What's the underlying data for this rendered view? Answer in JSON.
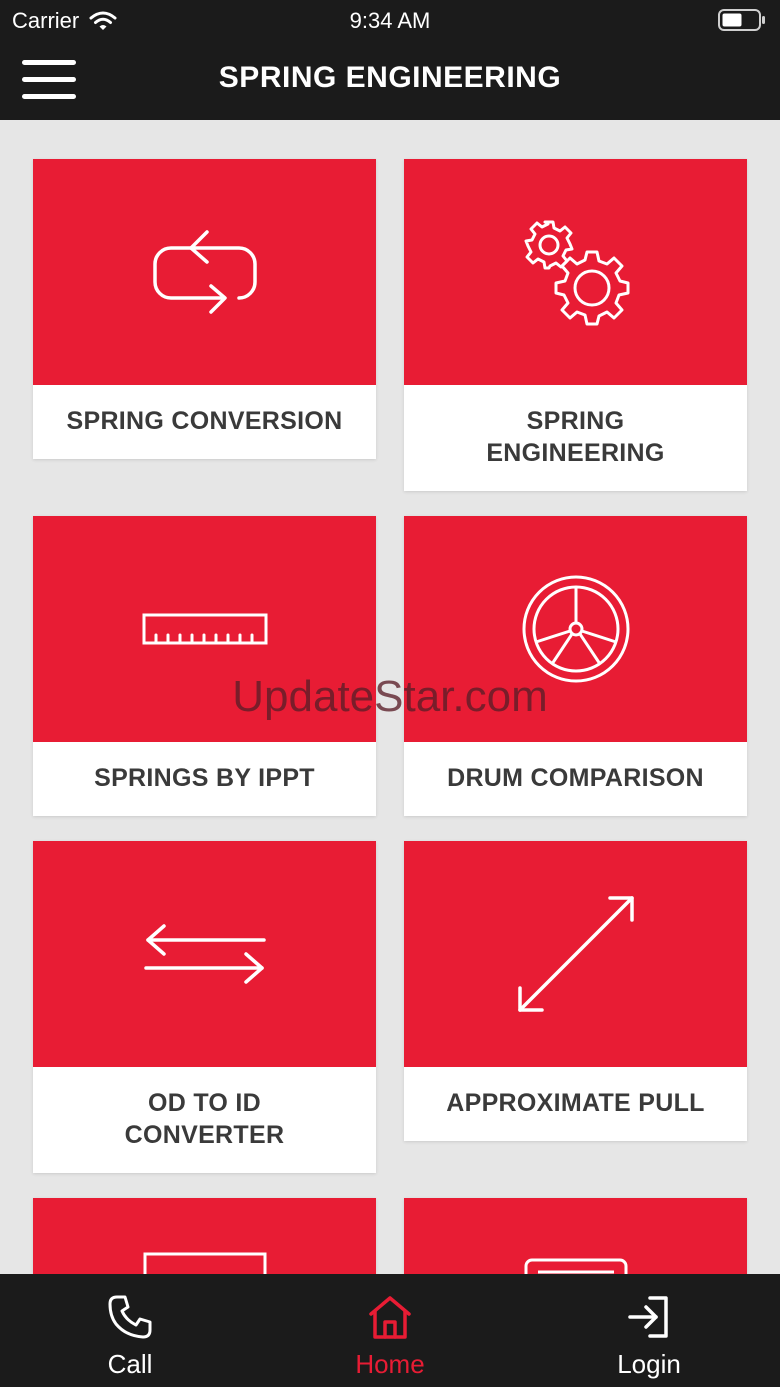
{
  "status_bar": {
    "carrier": "Carrier",
    "time": "9:34 AM"
  },
  "header": {
    "title": "SPRING ENGINEERING",
    "menu_icon": "hamburger-menu-icon"
  },
  "tiles": [
    {
      "label": "SPRING CONVERSION",
      "icon": "conversion-cycle-icon"
    },
    {
      "label": "SPRING\nENGINEERING",
      "icon": "gears-icon"
    },
    {
      "label": "SPRINGS BY IPPT",
      "icon": "ruler-icon"
    },
    {
      "label": "DRUM COMPARISON",
      "icon": "drum-wheel-icon"
    },
    {
      "label": "OD TO ID\nCONVERTER",
      "icon": "swap-arrows-icon"
    },
    {
      "label": "APPROXIMATE PULL",
      "icon": "diagonal-arrow-icon"
    },
    {
      "icon": "rectangle-icon"
    },
    {
      "icon": "card-icon"
    }
  ],
  "watermark": "UpdateStar.com",
  "tab_bar": [
    {
      "label": "Call",
      "icon": "phone-icon",
      "active": false
    },
    {
      "label": "Home",
      "icon": "home-icon",
      "active": true
    },
    {
      "label": "Login",
      "icon": "login-icon",
      "active": false
    }
  ],
  "colors": {
    "accent": "#e81c34",
    "bar_background": "#1b1b1b",
    "page_background": "#e6e6e6",
    "label_text": "#3a3a3a"
  }
}
